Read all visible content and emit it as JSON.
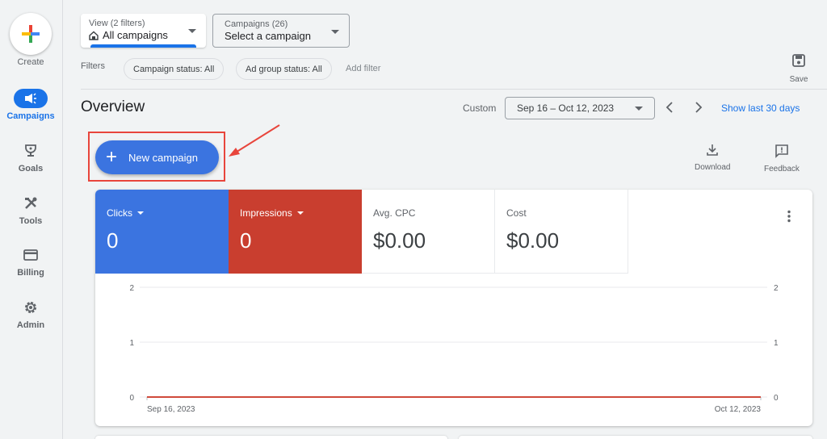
{
  "sidebar": {
    "create_label": "Create",
    "items": [
      {
        "label": "Campaigns",
        "icon": "megaphone-icon",
        "active": true
      },
      {
        "label": "Goals",
        "icon": "trophy-icon",
        "active": false
      },
      {
        "label": "Tools",
        "icon": "tools-icon",
        "active": false
      },
      {
        "label": "Billing",
        "icon": "credit-card-icon",
        "active": false
      },
      {
        "label": "Admin",
        "icon": "gear-icon",
        "active": false
      }
    ]
  },
  "view_dropdown": {
    "sublabel": "View (2 filters)",
    "value": "All campaigns",
    "icon": "home-icon"
  },
  "campaign_dropdown": {
    "sublabel": "Campaigns (26)",
    "value": "Select a campaign"
  },
  "filters": {
    "label": "Filters",
    "chips": [
      "Campaign status: All",
      "Ad group status: All"
    ],
    "add_filter": "Add filter"
  },
  "save": {
    "label": "Save",
    "icon": "save-icon"
  },
  "overview": {
    "title": "Overview",
    "date_mode": "Custom",
    "date_range": "Sep 16 – Oct 12, 2023",
    "show_last_link": "Show last 30 days"
  },
  "new_campaign": {
    "label": "New campaign",
    "icon": "plus-icon"
  },
  "toolbar": {
    "download_label": "Download",
    "feedback_label": "Feedback"
  },
  "metrics": [
    {
      "label": "Clicks",
      "value": "0",
      "color": "#3b74e0",
      "has_dropdown": true
    },
    {
      "label": "Impressions",
      "value": "0",
      "color": "#c93e2f",
      "has_dropdown": true
    },
    {
      "label": "Avg. CPC",
      "value": "$0.00"
    },
    {
      "label": "Cost",
      "value": "$0.00"
    }
  ],
  "chart_data": {
    "type": "line",
    "x_start_label": "Sep 16, 2023",
    "x_end_label": "Oct 12, 2023",
    "y_ticks_left": [
      "0",
      "1",
      "2"
    ],
    "y_ticks_right": [
      "0",
      "1",
      "2"
    ],
    "ylim": [
      0,
      2
    ],
    "grid": true,
    "series": [
      {
        "name": "Clicks",
        "color": "#3b74e0",
        "values": [
          0,
          0
        ]
      },
      {
        "name": "Impressions",
        "color": "#d04a3b",
        "values": [
          0,
          0
        ]
      }
    ]
  }
}
